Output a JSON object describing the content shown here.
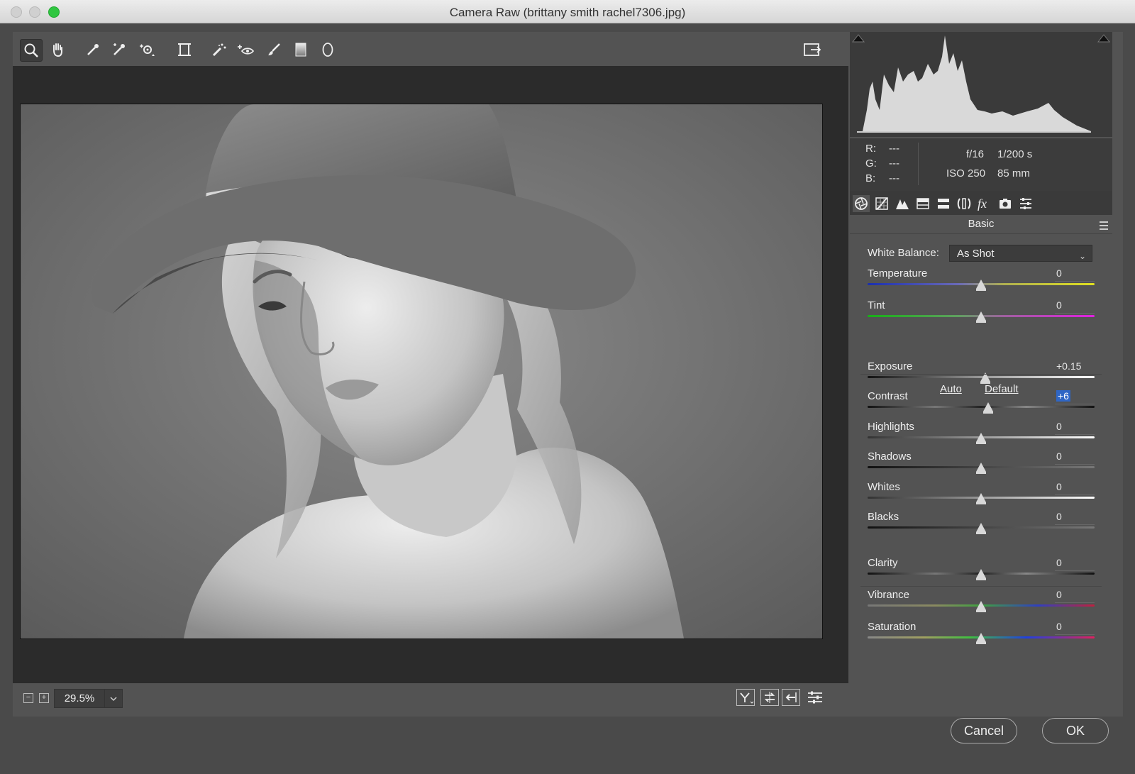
{
  "window": {
    "title": "Camera Raw (brittany smith rachel7306.jpg)"
  },
  "toolbar": {
    "tools": [
      "zoom-tool",
      "hand-tool",
      "white-balance-tool",
      "color-sampler-tool",
      "targeted-adjustment-tool",
      "transform-tool",
      "spot-removal-tool",
      "red-eye-tool",
      "adjustment-brush-tool",
      "graduated-filter-tool",
      "radial-filter-tool"
    ],
    "open_preferences": "toggle-fullscreen"
  },
  "zoom": {
    "value": "29.5%",
    "minus": "−",
    "plus": "+"
  },
  "info": {
    "r_label": "R:",
    "r_value": "---",
    "g_label": "G:",
    "g_value": "---",
    "b_label": "B:",
    "b_value": "---",
    "aperture": "f/16",
    "shutter": "1/200 s",
    "iso": "ISO 250",
    "focal": "85 mm"
  },
  "panel": {
    "title": "Basic",
    "tabs": [
      "basic",
      "tone-curve",
      "detail",
      "hsl",
      "split-toning",
      "lens-corrections",
      "effects",
      "camera-calibration",
      "presets"
    ],
    "white_balance_label": "White Balance:",
    "white_balance_value": "As Shot",
    "auto_label": "Auto",
    "default_label": "Default",
    "sliders": [
      {
        "name": "temperature",
        "label": "Temperature",
        "value": "0",
        "pos": 0.5
      },
      {
        "name": "tint",
        "label": "Tint",
        "value": "0",
        "pos": 0.5
      },
      {
        "name": "exposure",
        "label": "Exposure",
        "value": "+0.15",
        "pos": 0.52
      },
      {
        "name": "contrast",
        "label": "Contrast",
        "value": "+6",
        "pos": 0.53
      },
      {
        "name": "highlights",
        "label": "Highlights",
        "value": "0",
        "pos": 0.5
      },
      {
        "name": "shadows",
        "label": "Shadows",
        "value": "0",
        "pos": 0.5
      },
      {
        "name": "whites",
        "label": "Whites",
        "value": "0",
        "pos": 0.5
      },
      {
        "name": "blacks",
        "label": "Blacks",
        "value": "0",
        "pos": 0.5
      },
      {
        "name": "clarity",
        "label": "Clarity",
        "value": "0",
        "pos": 0.5
      },
      {
        "name": "vibrance",
        "label": "Vibrance",
        "value": "0",
        "pos": 0.5
      },
      {
        "name": "saturation",
        "label": "Saturation",
        "value": "0",
        "pos": 0.5
      }
    ]
  },
  "buttons": {
    "cancel": "Cancel",
    "ok": "OK"
  }
}
